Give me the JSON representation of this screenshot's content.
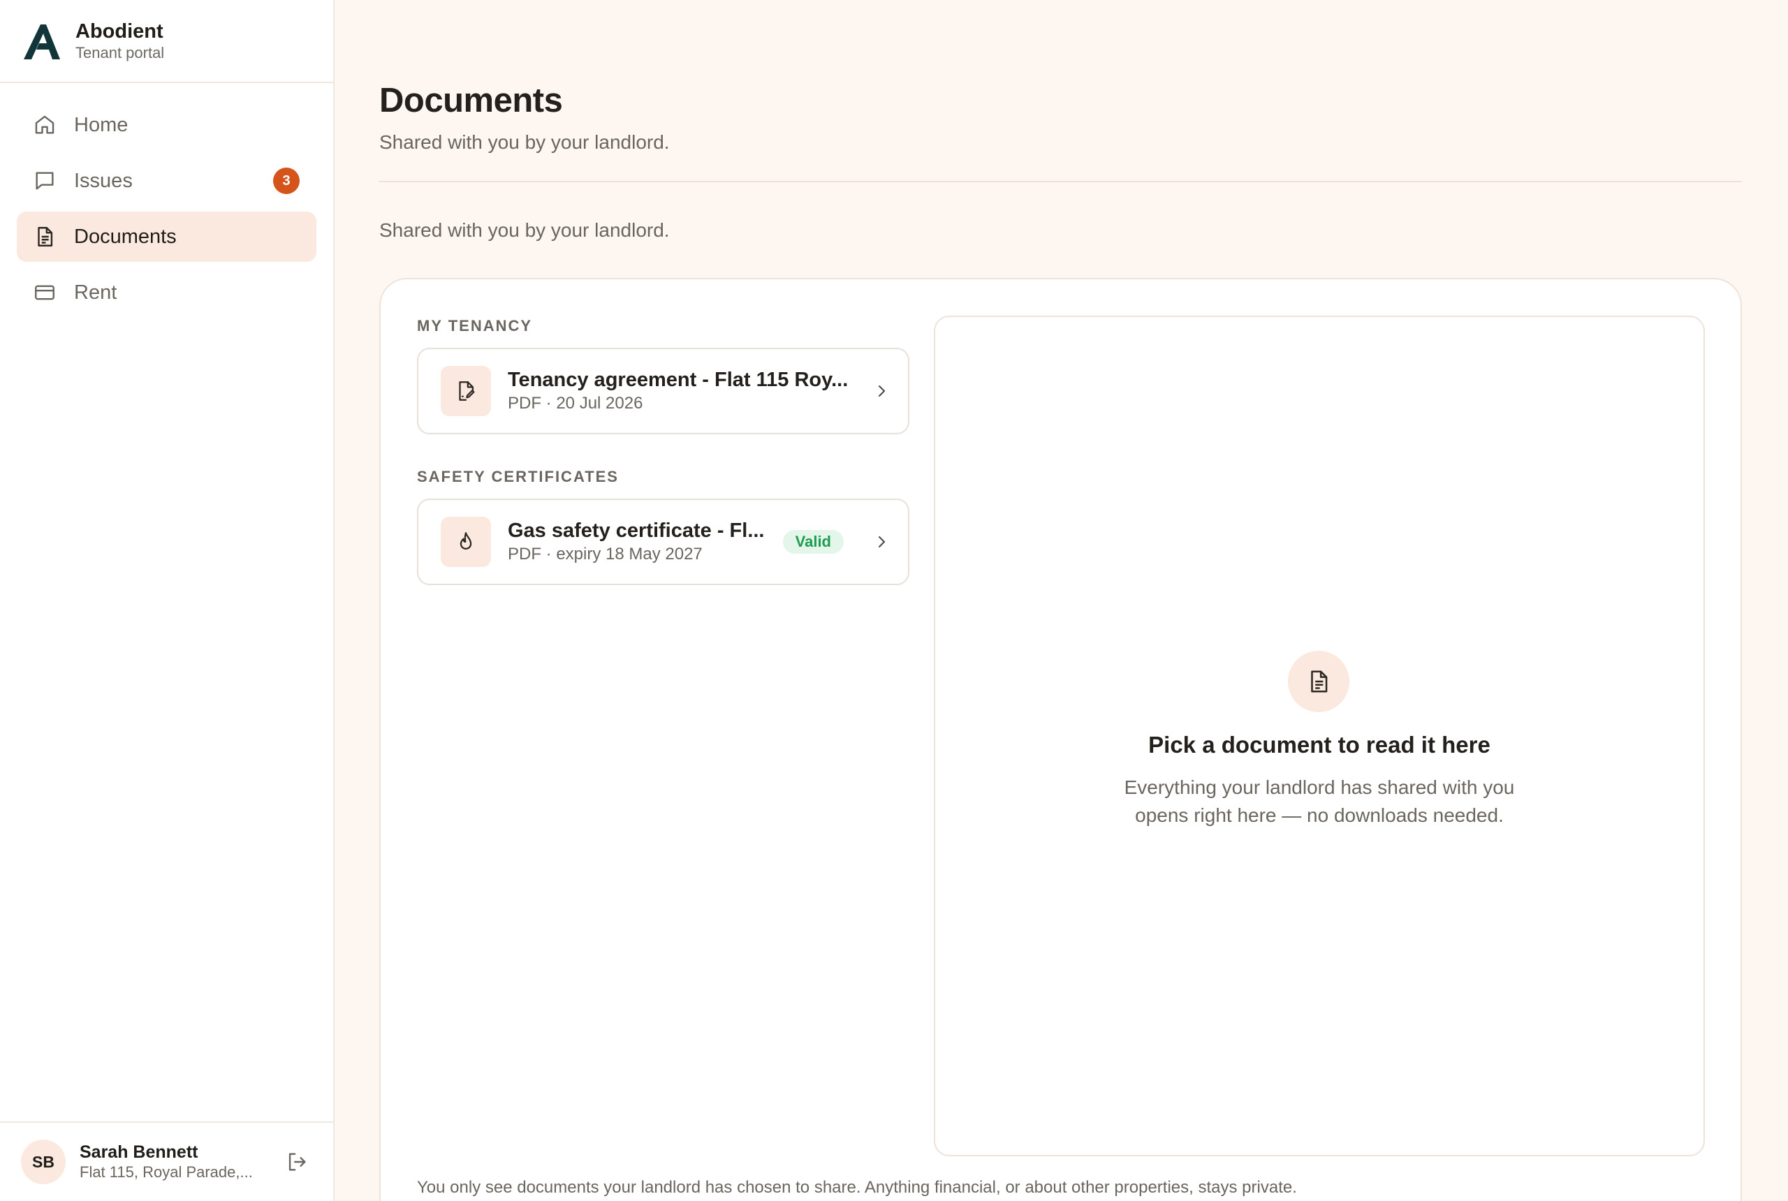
{
  "brand": {
    "name": "Abodient",
    "subtitle": "Tenant portal"
  },
  "nav": {
    "items": [
      {
        "label": "Home",
        "icon": "home-icon"
      },
      {
        "label": "Issues",
        "icon": "chat-icon",
        "badge": "3"
      },
      {
        "label": "Documents",
        "icon": "document-icon",
        "active": true
      },
      {
        "label": "Rent",
        "icon": "card-icon"
      }
    ]
  },
  "user": {
    "initials": "SB",
    "name": "Sarah Bennett",
    "address": "Flat 115, Royal Parade,..."
  },
  "page": {
    "title": "Documents",
    "subtitle": "Shared with you by your landlord.",
    "subtitle2": "Shared with you by your landlord."
  },
  "sections": [
    {
      "label": "MY TENANCY",
      "docs": [
        {
          "title": "Tenancy agreement - Flat 115 Roy...",
          "meta": "PDF · 20 Jul 2026",
          "icon": "signed-document-icon"
        }
      ]
    },
    {
      "label": "SAFETY CERTIFICATES",
      "docs": [
        {
          "title": "Gas safety certificate - Fl...",
          "meta": "PDF · expiry 18 May 2027",
          "status": "Valid",
          "icon": "flame-icon"
        }
      ]
    }
  ],
  "viewer": {
    "title": "Pick a document to read it here",
    "description_line1": "Everything your landlord has shared with you",
    "description_line2": "opens right here — no downloads needed."
  },
  "footnote": "You only see documents your landlord has chosen to share. Anything financial, or about other properties, stays private.",
  "colors": {
    "accent": "#d4541c",
    "active_bg": "#fbe9df",
    "valid_text": "#1c9d4f",
    "valid_bg": "#e4f6ea",
    "brand_mark": "#12353a"
  }
}
